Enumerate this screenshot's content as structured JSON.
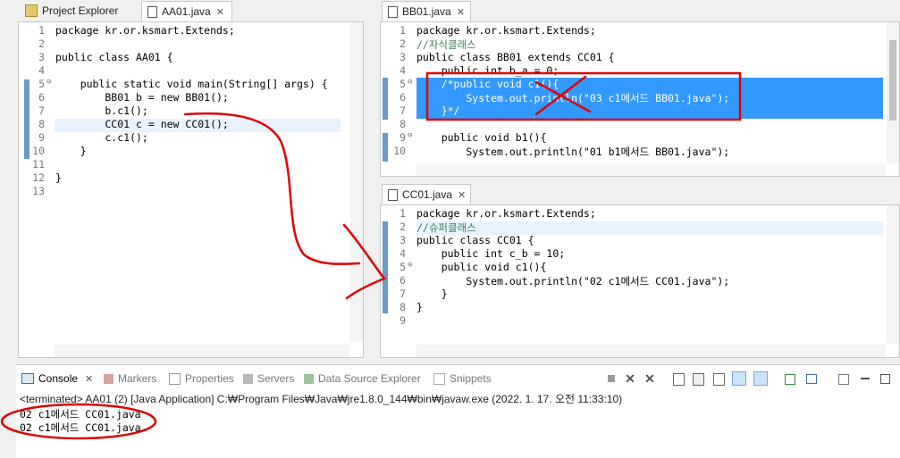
{
  "left_tabs": {
    "project_explorer": "Project Explorer",
    "aa01": "AA01.java",
    "close": "✕"
  },
  "right_top_tab": "BB01.java",
  "right_bottom_tab": "CC01.java",
  "aa01": {
    "line_numbers": [
      "1",
      "2",
      "3",
      "4",
      "5",
      "6",
      "7",
      "8",
      "9",
      "10",
      "11",
      "12",
      "13"
    ],
    "lines": [
      "package kr.or.ksmart.Extends;",
      "",
      "public class AA01 {",
      "",
      "    public static void main(String[] args) {",
      "        BB01 b = new BB01();",
      "        b.c1();",
      "        CC01 c = new CC01();",
      "        c.c1();",
      "    }",
      "",
      "}",
      ""
    ]
  },
  "bb01": {
    "line_numbers": [
      "1",
      "2",
      "3",
      "4",
      "5",
      "6",
      "7",
      "8",
      "9",
      "10"
    ],
    "lines": [
      "package kr.or.ksmart.Extends;",
      "//자식클래스",
      "public class BB01 extends CC01 {",
      "    public int b_a = 0;",
      "    /*public void c1(){",
      "        System.out.println(\"03 c1메서드 BB01.java\");",
      "    }*/",
      "",
      "    public void b1(){",
      "        System.out.println(\"01 b1메서드 BB01.java\");"
    ]
  },
  "cc01": {
    "line_numbers": [
      "1",
      "2",
      "3",
      "4",
      "5",
      "6",
      "7",
      "8",
      "9"
    ],
    "lines": [
      "package kr.or.ksmart.Extends;",
      "//슈퍼클래스",
      "public class CC01 {",
      "    public int c_b = 10;",
      "    public void c1(){",
      "        System.out.println(\"02 c1메서드 CC01.java\");",
      "    }",
      "}",
      ""
    ]
  },
  "console": {
    "tabs": [
      "Console",
      "Markers",
      "Properties",
      "Servers",
      "Data Source Explorer",
      "Snippets"
    ],
    "status": "<terminated> AA01 (2) [Java Application] C:₩Program Files₩Java₩jre1.8.0_144₩bin₩javaw.exe (2022. 1. 17. 오전 11:33:10)",
    "output": [
      "02 c1메서드 CC01.java",
      "02 c1메서드 CC01.java"
    ]
  },
  "icons": [
    "package-explorer-icon",
    "java-file-icon",
    "console-icon",
    "markers-icon",
    "properties-icon",
    "servers-icon",
    "data-source-icon",
    "snippets-icon"
  ],
  "colors": {
    "selection": "#3399ff",
    "keyword": "#7f0055",
    "comment": "#3f7f5f",
    "string": "#2a00ff",
    "annotation": "#e00000"
  }
}
